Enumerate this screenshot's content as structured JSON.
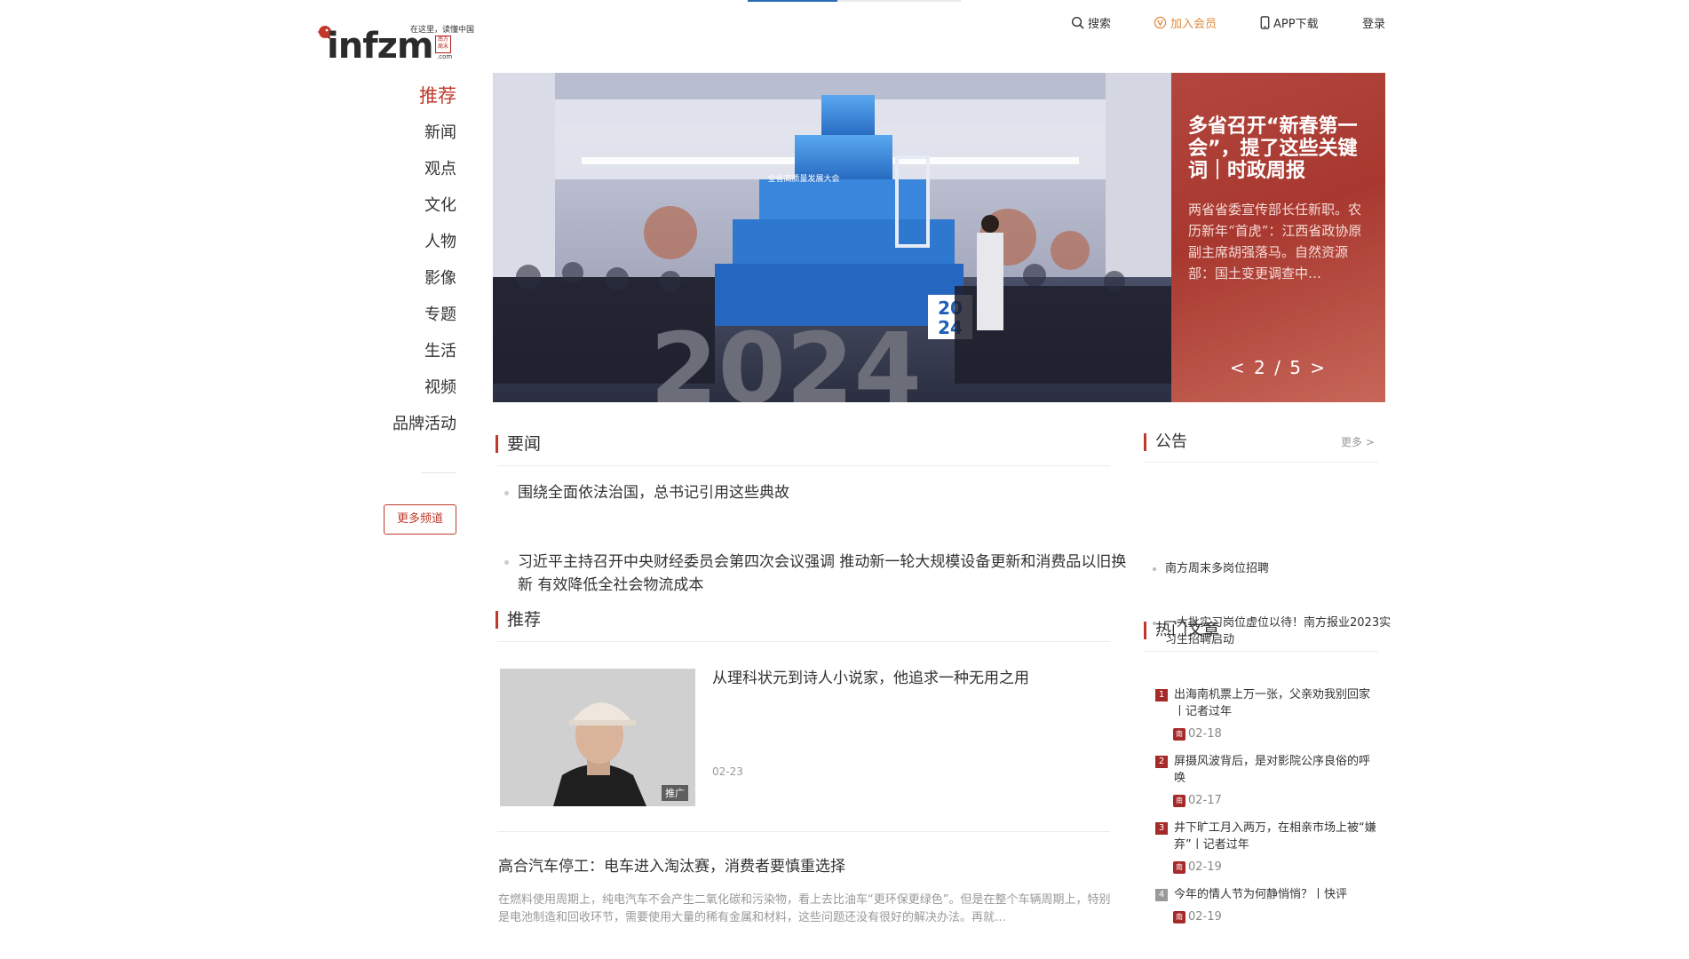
{
  "logo": {
    "word": "infzm",
    "slogan": "在这里，读懂中国",
    "seal": "南方周末",
    "com": ".com"
  },
  "topnav": {
    "search": "搜索",
    "member": "加入会员",
    "app": "APP下载",
    "login": "登录"
  },
  "sidebar": {
    "items": [
      "推荐",
      "新闻",
      "观点",
      "文化",
      "人物",
      "影像",
      "专题",
      "生活",
      "视频",
      "品牌活动"
    ],
    "more": "更多频道"
  },
  "banner": {
    "title": "多省召开“新春第一会”，提了这些关键词｜时政周报",
    "summary": "两省省委宣传部长任新职。农历新年“首虎”：江西省政协原副主席胡强落马。自然资源部：国土变更调查中…",
    "pager": "< 2 / 5 >",
    "image_texts": {
      "stage": "全省高质量发展大会",
      "year_small_1": "20",
      "year_small_2": "24",
      "year_big": "2024"
    },
    "progress": 0.42
  },
  "yaowen": {
    "heading": "要闻",
    "items": [
      "围绕全面依法治国，总书记引用这些典故",
      "习近平主持召开中央财经委员会第四次会议强调 推动新一轮大规模设备更新和消费品以旧换新 有效降低全社会物流成本"
    ]
  },
  "recommend": {
    "heading": "推荐",
    "featured": {
      "title": "从理科状元到诗人小说家，他追求一种无用之用",
      "date": "02-23",
      "badge": "推广"
    },
    "article2": {
      "title": "高合汽车停工：电车进入淘汰赛，消费者要慎重选择",
      "summary": "在燃料使用周期上，纯电汽车不会产生二氧化碳和污染物，看上去比油车“更环保更绿色”。但是在整个车辆周期上，特别是电池制造和回收环节，需要使用大量的稀有金属和材料，这些问题还没有很好的解决办法。再就…"
    }
  },
  "notice": {
    "heading": "公告",
    "more": "更多 >",
    "items": [
      "南方周末多岗位招聘",
      "一大批实习岗位虚位以待！南方报业2023实习生招聘启动"
    ]
  },
  "hot": {
    "heading": "热门文章",
    "items": [
      {
        "rank": "1",
        "title": "出海南机票上万一张，父亲劝我别回家丨记者过年",
        "date": "02-18"
      },
      {
        "rank": "2",
        "title": "屏摄风波背后，是对影院公序良俗的呼唤",
        "date": "02-17"
      },
      {
        "rank": "3",
        "title": "井下旷工月入两万，在相亲市场上被“嫌弃”丨记者过年",
        "date": "02-19"
      },
      {
        "rank": "4",
        "title": "今年的情人节为何静悄悄？丨快评",
        "date": "02-19"
      }
    ],
    "icon_text": "南周"
  },
  "colors": {
    "accent": "#c0392b",
    "member": "#e08a3c",
    "banner_side": "#a8382f"
  },
  "icons": {
    "search": "search-icon",
    "member": "vip-icon",
    "app": "phone-icon"
  }
}
